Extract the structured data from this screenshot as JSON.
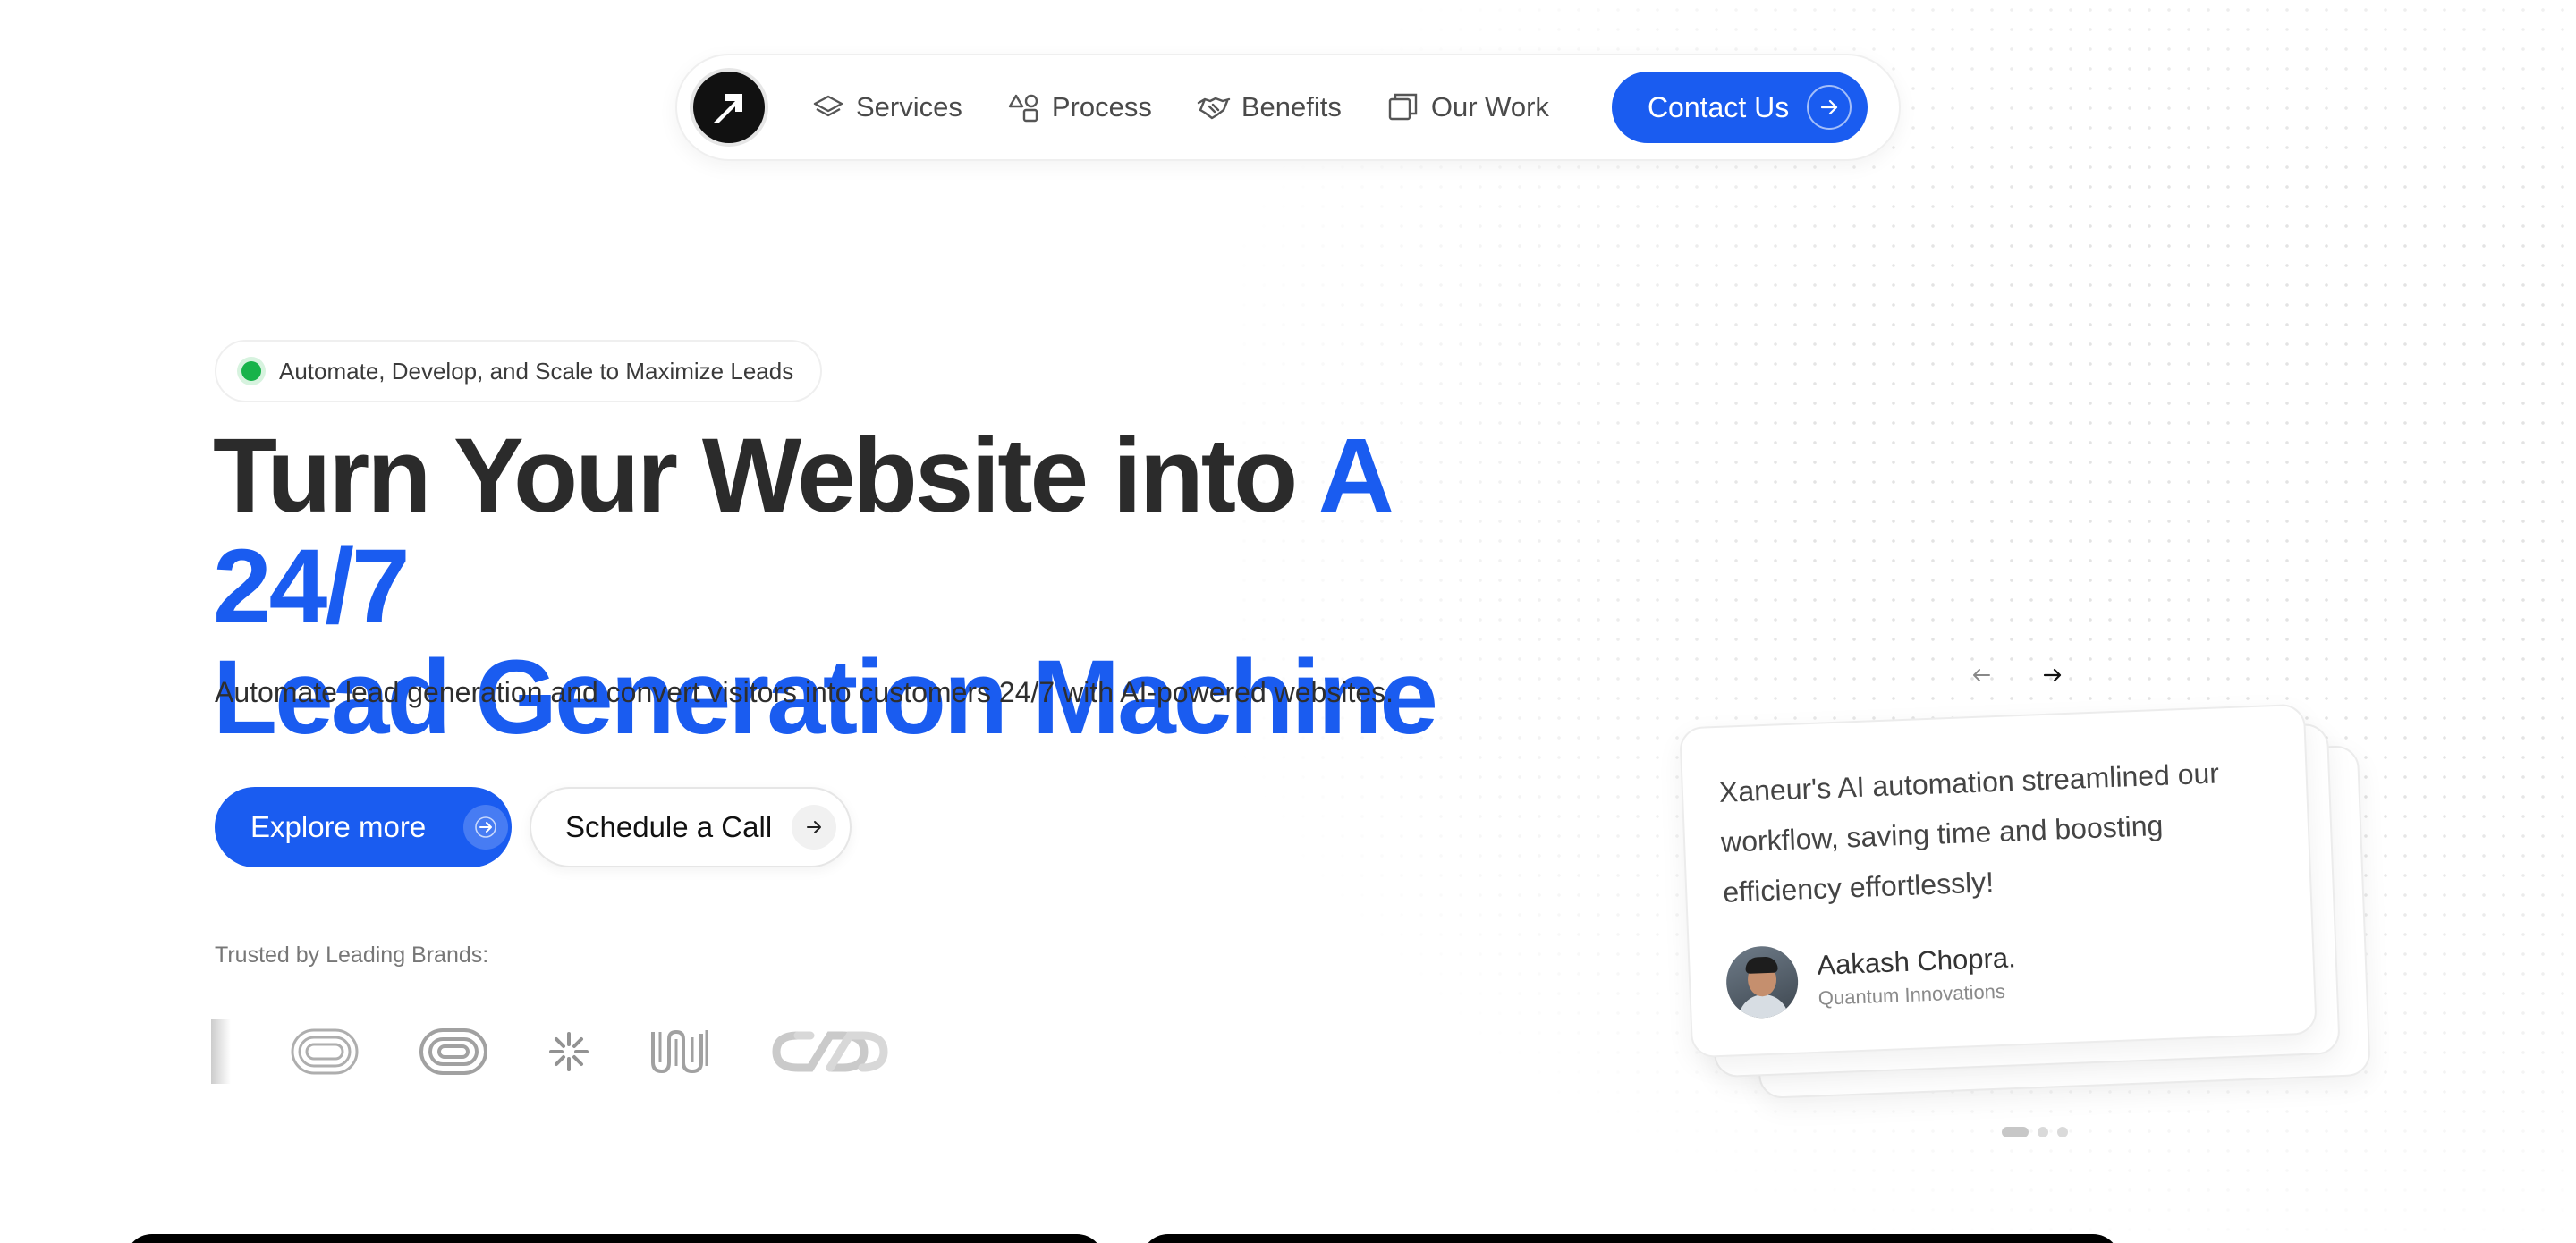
{
  "nav": {
    "items": [
      {
        "label": "Services",
        "icon": "layers-icon"
      },
      {
        "label": "Process",
        "icon": "shapes-icon"
      },
      {
        "label": "Benefits",
        "icon": "handshake-icon"
      },
      {
        "label": "Our Work",
        "icon": "windows-icon"
      }
    ],
    "contact_label": "Contact Us"
  },
  "hero": {
    "badge": "Automate, Develop, and Scale to Maximize Leads",
    "title_part1": "Turn Your Website into ",
    "title_highlight1": "A 24/7",
    "title_highlight2": "Lead Generation Machine",
    "subtitle": "Automate lead generation and convert visitors into customers 24/7 with AI-powered websites.",
    "explore_label": "Explore more",
    "schedule_label": "Schedule a Call",
    "trusted_label": "Trusted by Leading Brands:"
  },
  "testimonial": {
    "quote": "Xaneur's AI automation streamlined our workflow, saving time and boosting efficiency effortlessly!",
    "author": "Aakash Chopra.",
    "company": "Quantum Innovations",
    "page_count": 3,
    "active_page": 1
  },
  "colors": {
    "accent": "#1a5cf0",
    "text": "#2b2b2b",
    "status_dot": "#17b34a"
  }
}
